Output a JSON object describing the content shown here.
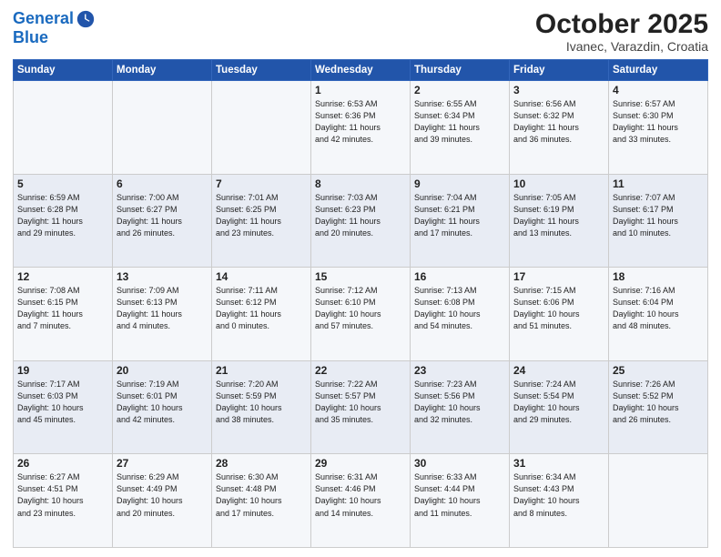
{
  "header": {
    "logo_line1": "General",
    "logo_line2": "Blue",
    "title": "October 2025",
    "subtitle": "Ivanec, Varazdin, Croatia"
  },
  "days_of_week": [
    "Sunday",
    "Monday",
    "Tuesday",
    "Wednesday",
    "Thursday",
    "Friday",
    "Saturday"
  ],
  "weeks": [
    [
      {
        "num": "",
        "info": ""
      },
      {
        "num": "",
        "info": ""
      },
      {
        "num": "",
        "info": ""
      },
      {
        "num": "1",
        "info": "Sunrise: 6:53 AM\nSunset: 6:36 PM\nDaylight: 11 hours\nand 42 minutes."
      },
      {
        "num": "2",
        "info": "Sunrise: 6:55 AM\nSunset: 6:34 PM\nDaylight: 11 hours\nand 39 minutes."
      },
      {
        "num": "3",
        "info": "Sunrise: 6:56 AM\nSunset: 6:32 PM\nDaylight: 11 hours\nand 36 minutes."
      },
      {
        "num": "4",
        "info": "Sunrise: 6:57 AM\nSunset: 6:30 PM\nDaylight: 11 hours\nand 33 minutes."
      }
    ],
    [
      {
        "num": "5",
        "info": "Sunrise: 6:59 AM\nSunset: 6:28 PM\nDaylight: 11 hours\nand 29 minutes."
      },
      {
        "num": "6",
        "info": "Sunrise: 7:00 AM\nSunset: 6:27 PM\nDaylight: 11 hours\nand 26 minutes."
      },
      {
        "num": "7",
        "info": "Sunrise: 7:01 AM\nSunset: 6:25 PM\nDaylight: 11 hours\nand 23 minutes."
      },
      {
        "num": "8",
        "info": "Sunrise: 7:03 AM\nSunset: 6:23 PM\nDaylight: 11 hours\nand 20 minutes."
      },
      {
        "num": "9",
        "info": "Sunrise: 7:04 AM\nSunset: 6:21 PM\nDaylight: 11 hours\nand 17 minutes."
      },
      {
        "num": "10",
        "info": "Sunrise: 7:05 AM\nSunset: 6:19 PM\nDaylight: 11 hours\nand 13 minutes."
      },
      {
        "num": "11",
        "info": "Sunrise: 7:07 AM\nSunset: 6:17 PM\nDaylight: 11 hours\nand 10 minutes."
      }
    ],
    [
      {
        "num": "12",
        "info": "Sunrise: 7:08 AM\nSunset: 6:15 PM\nDaylight: 11 hours\nand 7 minutes."
      },
      {
        "num": "13",
        "info": "Sunrise: 7:09 AM\nSunset: 6:13 PM\nDaylight: 11 hours\nand 4 minutes."
      },
      {
        "num": "14",
        "info": "Sunrise: 7:11 AM\nSunset: 6:12 PM\nDaylight: 11 hours\nand 0 minutes."
      },
      {
        "num": "15",
        "info": "Sunrise: 7:12 AM\nSunset: 6:10 PM\nDaylight: 10 hours\nand 57 minutes."
      },
      {
        "num": "16",
        "info": "Sunrise: 7:13 AM\nSunset: 6:08 PM\nDaylight: 10 hours\nand 54 minutes."
      },
      {
        "num": "17",
        "info": "Sunrise: 7:15 AM\nSunset: 6:06 PM\nDaylight: 10 hours\nand 51 minutes."
      },
      {
        "num": "18",
        "info": "Sunrise: 7:16 AM\nSunset: 6:04 PM\nDaylight: 10 hours\nand 48 minutes."
      }
    ],
    [
      {
        "num": "19",
        "info": "Sunrise: 7:17 AM\nSunset: 6:03 PM\nDaylight: 10 hours\nand 45 minutes."
      },
      {
        "num": "20",
        "info": "Sunrise: 7:19 AM\nSunset: 6:01 PM\nDaylight: 10 hours\nand 42 minutes."
      },
      {
        "num": "21",
        "info": "Sunrise: 7:20 AM\nSunset: 5:59 PM\nDaylight: 10 hours\nand 38 minutes."
      },
      {
        "num": "22",
        "info": "Sunrise: 7:22 AM\nSunset: 5:57 PM\nDaylight: 10 hours\nand 35 minutes."
      },
      {
        "num": "23",
        "info": "Sunrise: 7:23 AM\nSunset: 5:56 PM\nDaylight: 10 hours\nand 32 minutes."
      },
      {
        "num": "24",
        "info": "Sunrise: 7:24 AM\nSunset: 5:54 PM\nDaylight: 10 hours\nand 29 minutes."
      },
      {
        "num": "25",
        "info": "Sunrise: 7:26 AM\nSunset: 5:52 PM\nDaylight: 10 hours\nand 26 minutes."
      }
    ],
    [
      {
        "num": "26",
        "info": "Sunrise: 6:27 AM\nSunset: 4:51 PM\nDaylight: 10 hours\nand 23 minutes."
      },
      {
        "num": "27",
        "info": "Sunrise: 6:29 AM\nSunset: 4:49 PM\nDaylight: 10 hours\nand 20 minutes."
      },
      {
        "num": "28",
        "info": "Sunrise: 6:30 AM\nSunset: 4:48 PM\nDaylight: 10 hours\nand 17 minutes."
      },
      {
        "num": "29",
        "info": "Sunrise: 6:31 AM\nSunset: 4:46 PM\nDaylight: 10 hours\nand 14 minutes."
      },
      {
        "num": "30",
        "info": "Sunrise: 6:33 AM\nSunset: 4:44 PM\nDaylight: 10 hours\nand 11 minutes."
      },
      {
        "num": "31",
        "info": "Sunrise: 6:34 AM\nSunset: 4:43 PM\nDaylight: 10 hours\nand 8 minutes."
      },
      {
        "num": "",
        "info": ""
      }
    ]
  ]
}
